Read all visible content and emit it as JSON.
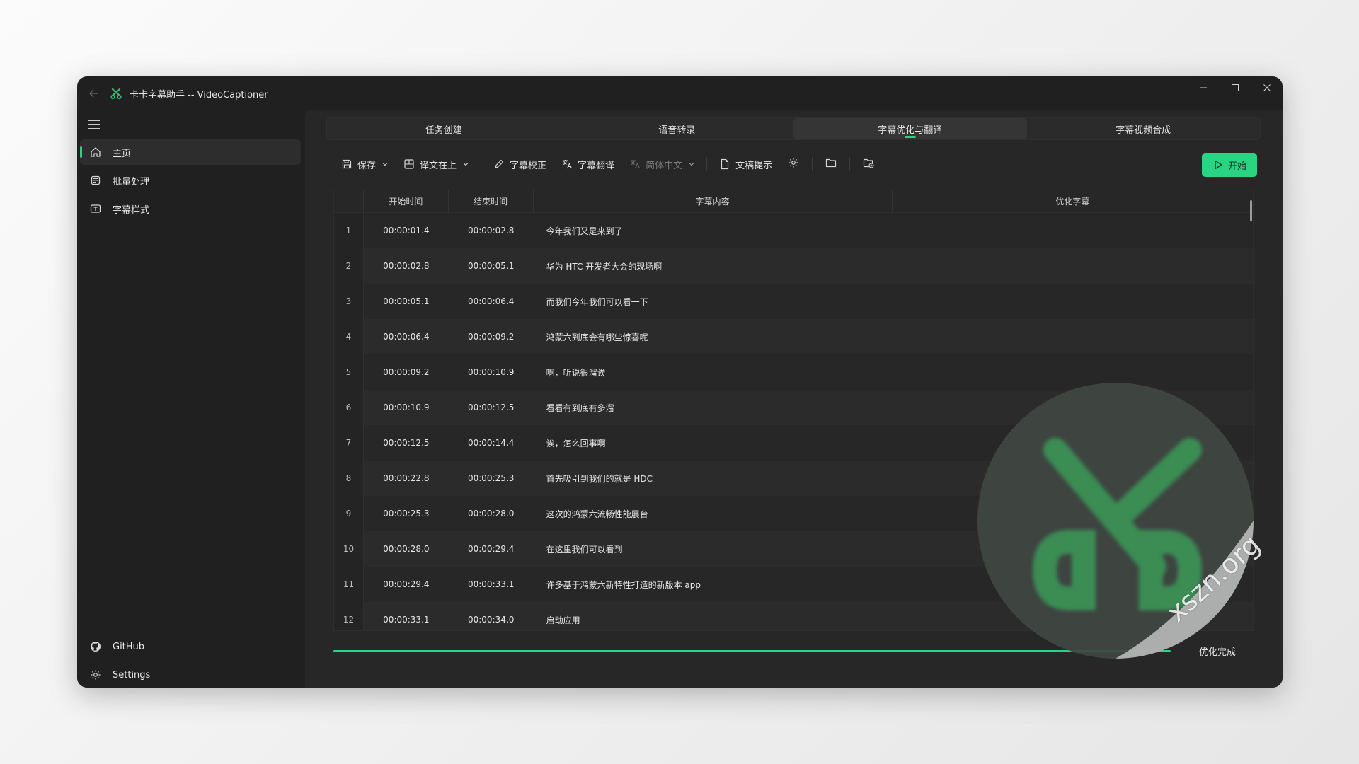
{
  "window": {
    "title": "卡卡字幕助手 -- VideoCaptioner"
  },
  "sidebar": {
    "items": [
      {
        "label": "主页",
        "icon": "home-icon",
        "active": true
      },
      {
        "label": "批量处理",
        "icon": "batch-icon",
        "active": false
      },
      {
        "label": "字幕样式",
        "icon": "subtitle-style-icon",
        "active": false
      }
    ],
    "bottom_items": [
      {
        "label": "GitHub",
        "icon": "github-icon"
      },
      {
        "label": "Settings",
        "icon": "gear-icon"
      }
    ]
  },
  "tabs": [
    {
      "label": "任务创建",
      "active": false
    },
    {
      "label": "语音转录",
      "active": false
    },
    {
      "label": "字幕优化与翻译",
      "active": true
    },
    {
      "label": "字幕视频合成",
      "active": false
    }
  ],
  "toolbar": {
    "save_label": "保存",
    "layout_label": "译文在上",
    "correct_label": "字幕校正",
    "translate_label": "字幕翻译",
    "language_label": "简体中文",
    "prompt_label": "文稿提示",
    "start_label": "开始"
  },
  "table": {
    "headers": [
      "开始时间",
      "结束时间",
      "字幕内容",
      "优化字幕"
    ],
    "rows": [
      {
        "num": "1",
        "start": "00:00:01.4",
        "end": "00:00:02.8",
        "text": "今年我们又是来到了",
        "optimized": ""
      },
      {
        "num": "2",
        "start": "00:00:02.8",
        "end": "00:00:05.1",
        "text": "华为 HTC 开发者大会的现场啊",
        "optimized": ""
      },
      {
        "num": "3",
        "start": "00:00:05.1",
        "end": "00:00:06.4",
        "text": "而我们今年我们可以看一下",
        "optimized": ""
      },
      {
        "num": "4",
        "start": "00:00:06.4",
        "end": "00:00:09.2",
        "text": "鸿蒙六到底会有哪些惊喜呢",
        "optimized": ""
      },
      {
        "num": "5",
        "start": "00:00:09.2",
        "end": "00:00:10.9",
        "text": "啊，听说很溜诶",
        "optimized": ""
      },
      {
        "num": "6",
        "start": "00:00:10.9",
        "end": "00:00:12.5",
        "text": "看看有到底有多溜",
        "optimized": ""
      },
      {
        "num": "7",
        "start": "00:00:12.5",
        "end": "00:00:14.4",
        "text": "诶，怎么回事啊",
        "optimized": ""
      },
      {
        "num": "8",
        "start": "00:00:22.8",
        "end": "00:00:25.3",
        "text": "首先吸引到我们的就是 HDC",
        "optimized": ""
      },
      {
        "num": "9",
        "start": "00:00:25.3",
        "end": "00:00:28.0",
        "text": "这次的鸿蒙六流畅性能展台",
        "optimized": ""
      },
      {
        "num": "10",
        "start": "00:00:28.0",
        "end": "00:00:29.4",
        "text": "在这里我们可以看到",
        "optimized": ""
      },
      {
        "num": "11",
        "start": "00:00:29.4",
        "end": "00:00:33.1",
        "text": "许多基于鸿蒙六新特性打造的新版本 app",
        "optimized": ""
      },
      {
        "num": "12",
        "start": "00:00:33.1",
        "end": "00:00:34.0",
        "text": "启动应用",
        "optimized": ""
      }
    ]
  },
  "progress": {
    "value_percent": 100,
    "status": "优化完成"
  },
  "watermark": {
    "text": "xszn.org"
  },
  "colors": {
    "accent": "#2bd483",
    "window_bg": "#202020",
    "content_bg": "#272727"
  }
}
